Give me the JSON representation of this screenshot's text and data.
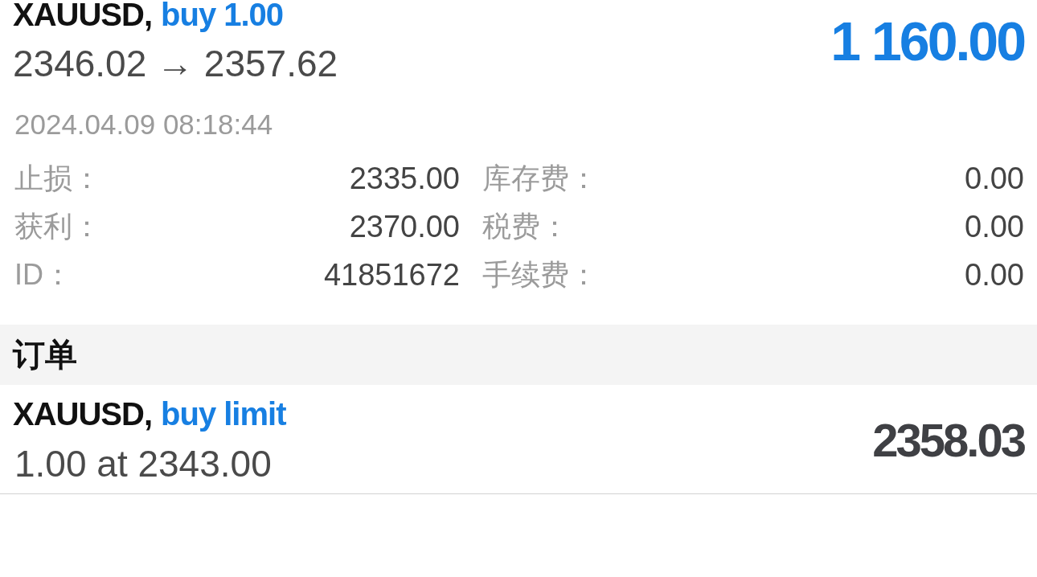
{
  "position": {
    "symbol": "XAUUSD,",
    "side": "buy 1.00",
    "prices": "2346.02 → 2357.62",
    "profit": "1 160.00",
    "time": "2024.04.09 08:18:44",
    "details": [
      [
        {
          "label": "止损：",
          "value": "2335.00"
        },
        {
          "label": "库存费：",
          "value": "0.00"
        }
      ],
      [
        {
          "label": "获利：",
          "value": "2370.00"
        },
        {
          "label": "税费：",
          "value": "0.00"
        }
      ],
      [
        {
          "label": "ID：",
          "value": "41851672"
        },
        {
          "label": "手续费：",
          "value": "0.00"
        }
      ]
    ]
  },
  "orders": {
    "title": "订单",
    "items": [
      {
        "symbol": "XAUUSD,",
        "type": "buy limit",
        "detail": "1.00 at 2343.00",
        "price": "2358.03"
      }
    ]
  }
}
